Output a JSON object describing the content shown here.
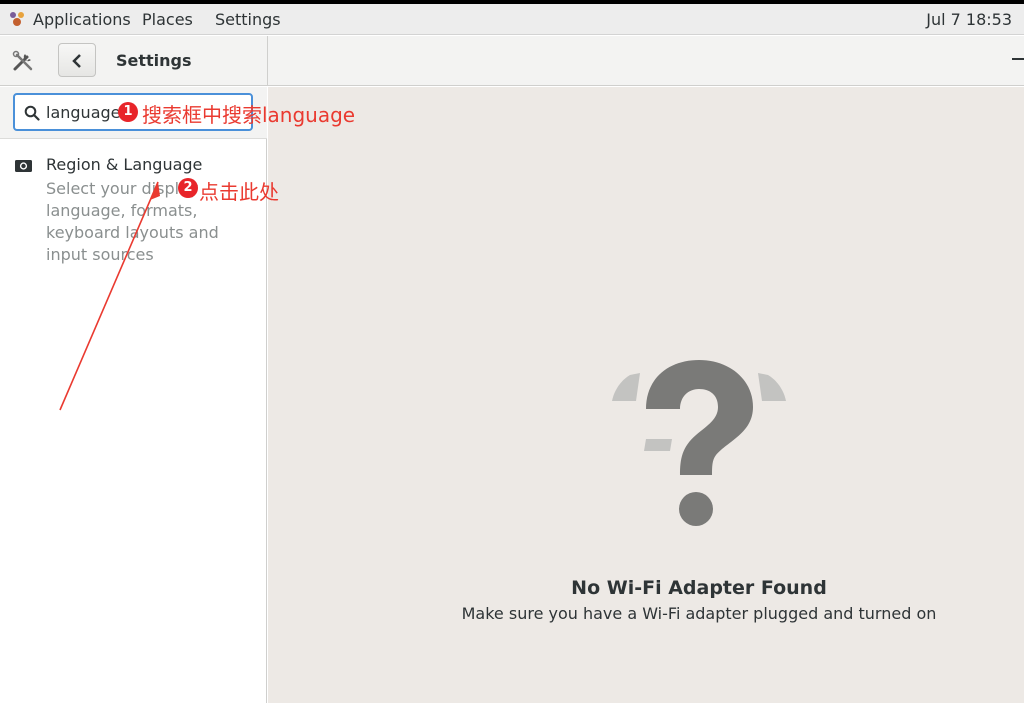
{
  "topbar": {
    "menus": [
      "Applications",
      "Places",
      "Settings"
    ],
    "clock": "Jul 7  18:53"
  },
  "headerbar": {
    "title": "Settings"
  },
  "search": {
    "value": "language"
  },
  "results": [
    {
      "title": "Region & Language",
      "description": "Select your display language, formats, keyboard layouts and input sources",
      "icon": "region-icon"
    }
  ],
  "content": {
    "empty_title": "No Wi-Fi Adapter Found",
    "empty_subtitle": "Make sure you have a Wi-Fi adapter plugged and turned on",
    "icon": "question-mark-icon"
  },
  "annotations": [
    {
      "badge": "1",
      "text": "搜索框中搜索language"
    },
    {
      "badge": "2",
      "text": "点击此处"
    }
  ],
  "colors": {
    "accent": "#4a90d9",
    "annotation": "#ea3a30",
    "content_bg": "#ede9e5"
  }
}
